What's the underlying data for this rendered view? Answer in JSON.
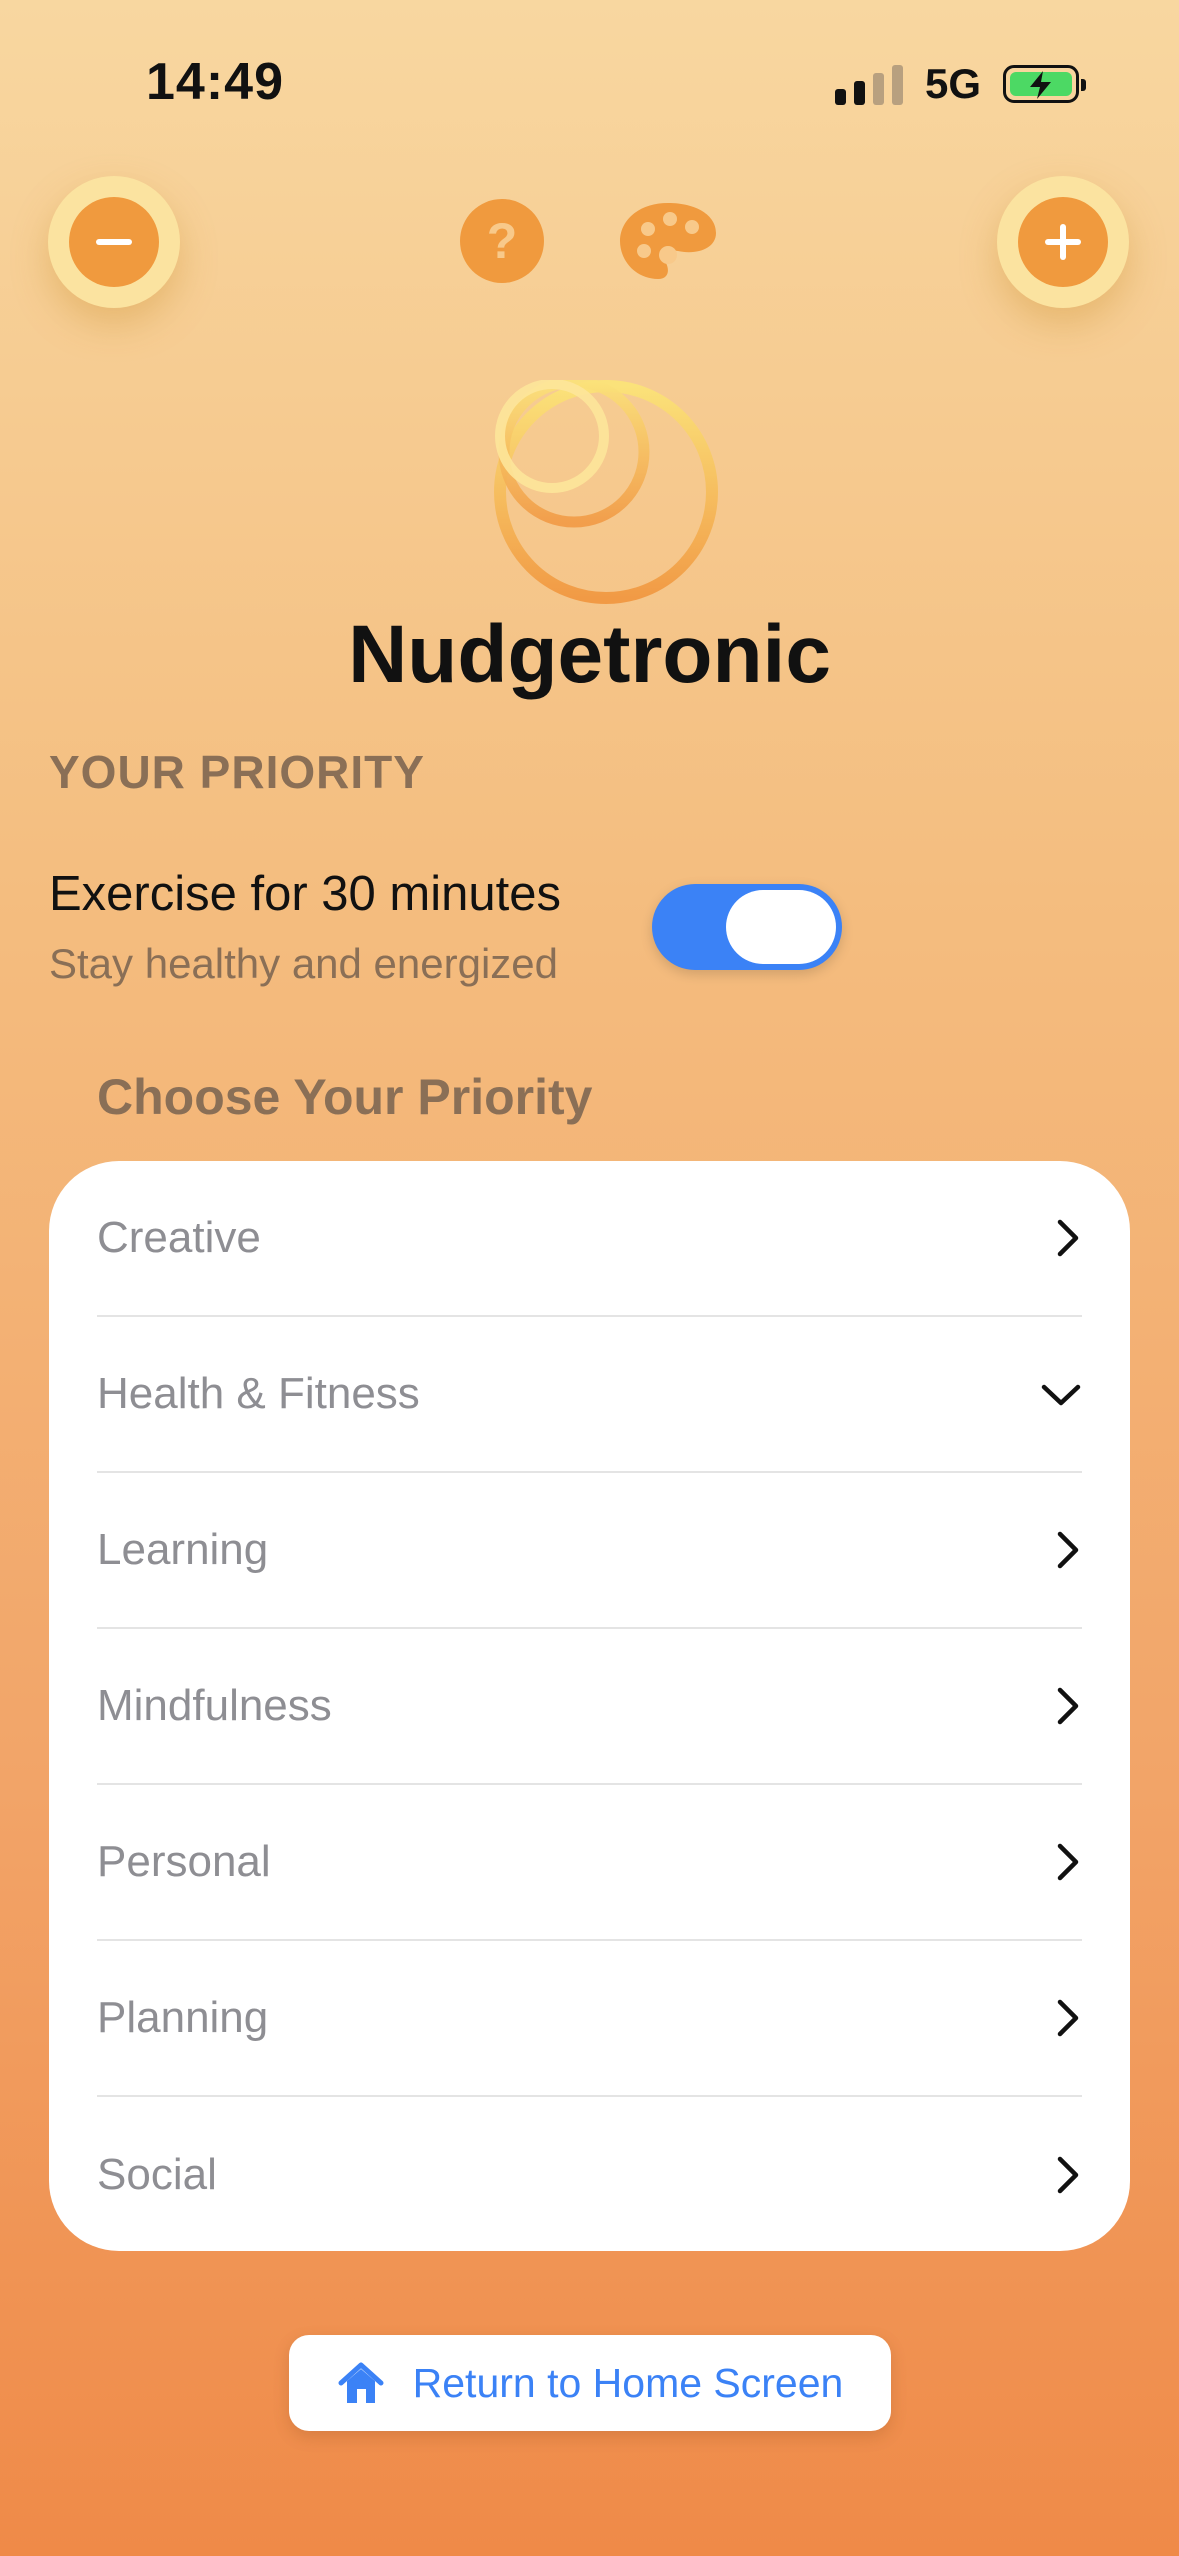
{
  "status_bar": {
    "time": "14:49",
    "network": "5G",
    "signal_bars_filled": 2,
    "battery_state": "charging"
  },
  "toolbar": {
    "remove_icon": "minus-circle-icon",
    "help_icon": "question-icon",
    "theme_icon": "palette-icon",
    "add_icon": "plus-circle-icon"
  },
  "app": {
    "title": "Nudgetronic"
  },
  "your_priority": {
    "section_label": "YOUR PRIORITY",
    "title": "Exercise for 30 minutes",
    "subtitle": "Stay healthy and energized",
    "toggle_on": true
  },
  "choose": {
    "heading": "Choose Your Priority",
    "categories": [
      {
        "label": "Creative",
        "expanded": false
      },
      {
        "label": "Health & Fitness",
        "expanded": true
      },
      {
        "label": "Learning",
        "expanded": false
      },
      {
        "label": "Mindfulness",
        "expanded": false
      },
      {
        "label": "Personal",
        "expanded": false
      },
      {
        "label": "Planning",
        "expanded": false
      },
      {
        "label": "Social",
        "expanded": false
      }
    ]
  },
  "footer": {
    "home_button_label": "Return to Home Screen",
    "home_icon": "house-icon"
  },
  "colors": {
    "accent": "#f09a3e",
    "toggle": "#3b82f6",
    "link": "#3b82f6",
    "label": "#8a6f56"
  }
}
